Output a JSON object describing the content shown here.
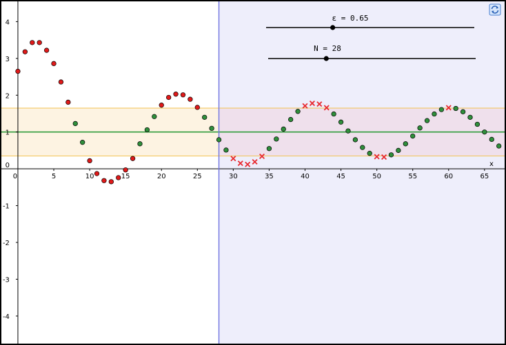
{
  "sliders": [
    {
      "name": "ε",
      "label": "ε = 0.65",
      "value": 0.65,
      "fraction": 0.32
    },
    {
      "name": "N",
      "label": "N = 28",
      "value": 28,
      "fraction": 0.28
    }
  ],
  "refresh_icon": "refresh-icon",
  "colors": {
    "band_fill": "#fdf3e2",
    "band_fill_right": "#efe0ec",
    "band_edge": "#f2c250",
    "limit_line": "#2e9b3a",
    "n_line": "#6f72e0",
    "right_shade": "#eeeefb",
    "inside_point": "#2f8f3b",
    "outside_point": "#e01a1a",
    "after_n_outside": "#e8292f"
  },
  "chart_data": {
    "type": "scatter",
    "xlabel": "x",
    "ylabel": "",
    "xlim": [
      -2.3,
      67.8
    ],
    "ylim": [
      -4.75,
      4.55
    ],
    "x_ticks": [
      "0",
      "5",
      "10",
      "15",
      "20",
      "25",
      "30",
      "35",
      "40",
      "45",
      "50",
      "55",
      "60",
      "65"
    ],
    "y_ticks": [
      "4",
      "3",
      "2",
      "1",
      "0",
      "-1",
      "-2",
      "-3",
      "-4"
    ],
    "limit": 1,
    "epsilon": 0.65,
    "N": 28,
    "grid": false,
    "series": [
      {
        "x": [
          0,
          1,
          2,
          3,
          4,
          5,
          6,
          7,
          8,
          9,
          10,
          11,
          12,
          13,
          14,
          15,
          16,
          17,
          18,
          19,
          20,
          21,
          22,
          23,
          24,
          25,
          26,
          27,
          28,
          29,
          30,
          31,
          32,
          33,
          34,
          35,
          36,
          37,
          38,
          39,
          40,
          41,
          42,
          43,
          44,
          45,
          46,
          47,
          48,
          49,
          50,
          51,
          52,
          53,
          54,
          55,
          56,
          57,
          58,
          59,
          60,
          61,
          62,
          63,
          64,
          65,
          66,
          67
        ],
        "values": [
          2.65,
          3.18,
          3.43,
          3.43,
          3.22,
          2.86,
          2.36,
          1.81,
          1.23,
          0.72,
          0.22,
          -0.13,
          -0.32,
          -0.35,
          -0.24,
          -0.03,
          0.28,
          0.68,
          1.06,
          1.42,
          1.73,
          1.94,
          2.03,
          2.01,
          1.89,
          1.67,
          1.4,
          1.1,
          0.79,
          0.51,
          0.28,
          0.15,
          0.12,
          0.19,
          0.34,
          0.55,
          0.81,
          1.08,
          1.34,
          1.56,
          1.71,
          1.78,
          1.76,
          1.66,
          1.49,
          1.27,
          1.03,
          0.79,
          0.58,
          0.42,
          0.33,
          0.32,
          0.38,
          0.5,
          0.68,
          0.89,
          1.11,
          1.31,
          1.49,
          1.61,
          1.66,
          1.64,
          1.55,
          1.4,
          1.21,
          1.0,
          0.8,
          0.62
        ]
      }
    ]
  }
}
